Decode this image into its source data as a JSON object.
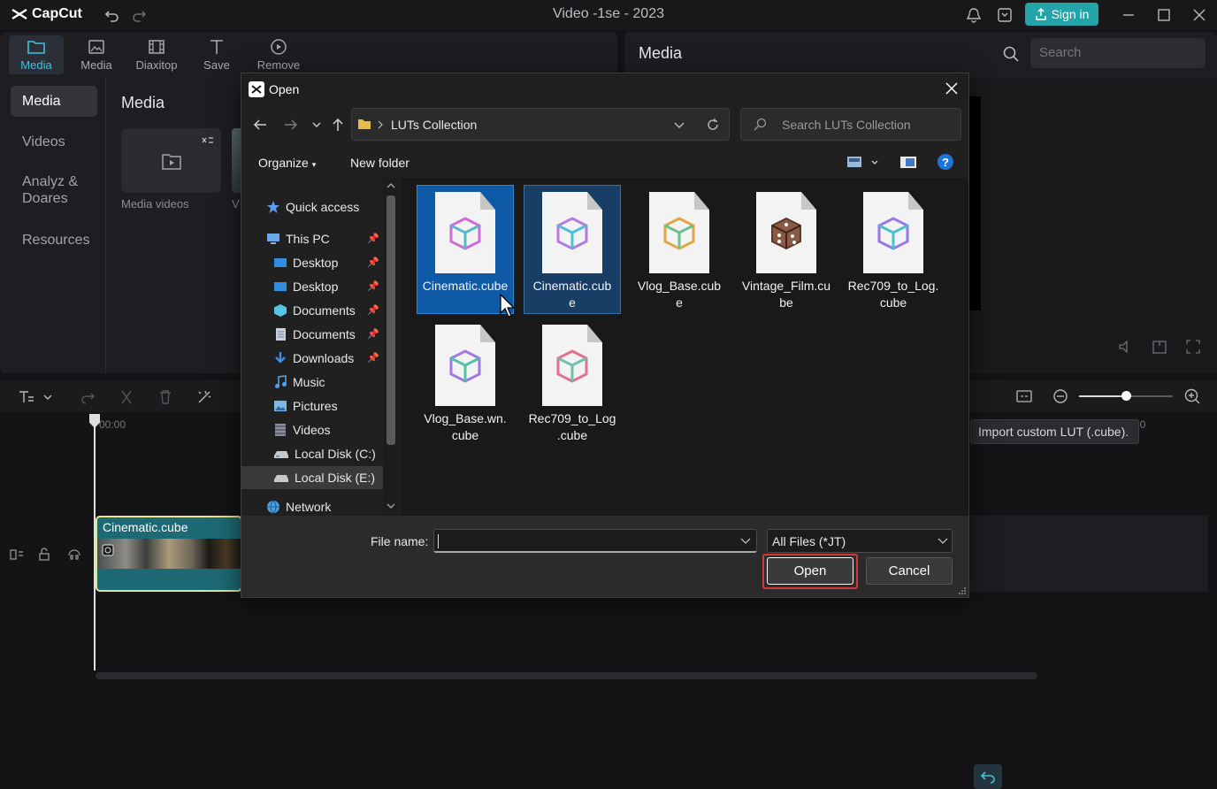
{
  "app": {
    "logo_text": "CapCut",
    "title": "Video -1se - 2023",
    "sign_in": "Sign in"
  },
  "toolbar": {
    "items": [
      {
        "label": "Media",
        "icon": "folder-icon",
        "active": true
      },
      {
        "label": "Media",
        "icon": "image-icon"
      },
      {
        "label": "Diaxitop",
        "icon": "film-icon"
      },
      {
        "label": "Save",
        "icon": "text-icon"
      },
      {
        "label": "Remove",
        "icon": "sticker-icon"
      }
    ]
  },
  "sidenav": {
    "items": [
      {
        "label": "Media",
        "active": true
      },
      {
        "label": "Videos"
      },
      {
        "label": "Analyz &\nDoares"
      },
      {
        "label": "Resources"
      }
    ]
  },
  "media_panel": {
    "heading": "Media",
    "card_label": "Media videos",
    "card_label2": "V"
  },
  "right_panel": {
    "title": "Media",
    "search_placeholder": "Search"
  },
  "timeline": {
    "timecode_start": "00:00",
    "timecode_end": "00",
    "clip_label": "Cinematic.cube",
    "tooltip": "Import custom LUT (.cube)."
  },
  "dialog": {
    "title": "Open",
    "address": "LUTs Collection",
    "search_placeholder": "Search LUTs Collection",
    "organize": "Organize",
    "new_folder": "New folder",
    "tree": [
      {
        "label": "Quick access",
        "icon": "star-icon"
      },
      {
        "label": "This PC",
        "icon": "computer-icon",
        "pin": true
      },
      {
        "label": "Desktop",
        "icon": "desktop-icon",
        "pin": true
      },
      {
        "label": "Desktop",
        "icon": "desktop-icon",
        "pin": true
      },
      {
        "label": "Documents",
        "icon": "documents-cube-icon",
        "pin": true
      },
      {
        "label": "Documents",
        "icon": "documents-icon",
        "pin": true
      },
      {
        "label": "Downloads",
        "icon": "download-icon",
        "pin": true
      },
      {
        "label": "Music",
        "icon": "music-icon"
      },
      {
        "label": "Pictures",
        "icon": "pictures-icon"
      },
      {
        "label": "Videos",
        "icon": "videos-icon"
      },
      {
        "label": "Local Disk (C:)",
        "icon": "disk-icon"
      },
      {
        "label": "Local Disk (E:)",
        "icon": "disk-icon",
        "selected": true
      },
      {
        "label": "Network",
        "icon": "network-icon"
      }
    ],
    "files": [
      {
        "name": "Cinematic.cube",
        "state": "selected"
      },
      {
        "name": "Cinematic.cub\ne",
        "state": "selected2"
      },
      {
        "name": "Vlog_Base.cub\ne",
        "state": "none"
      },
      {
        "name": "Vintage_Film.cu\nbe",
        "state": "none"
      },
      {
        "name": "Rec709_to_Log.\ncube",
        "state": "none"
      },
      {
        "name": "Vlog_Base.wn.\ncube",
        "state": "none"
      },
      {
        "name": "Rec709_to_Log\n.cube",
        "state": "none"
      }
    ],
    "file_name_label": "File name:",
    "file_name_value": "",
    "file_type": "All Files (*JT)",
    "open_button": "Open",
    "cancel_button": "Cancel"
  },
  "colors": {
    "accent": "#22a4a8",
    "selection": "#0f5aa6",
    "highlight_outline": "#d23a3a"
  }
}
